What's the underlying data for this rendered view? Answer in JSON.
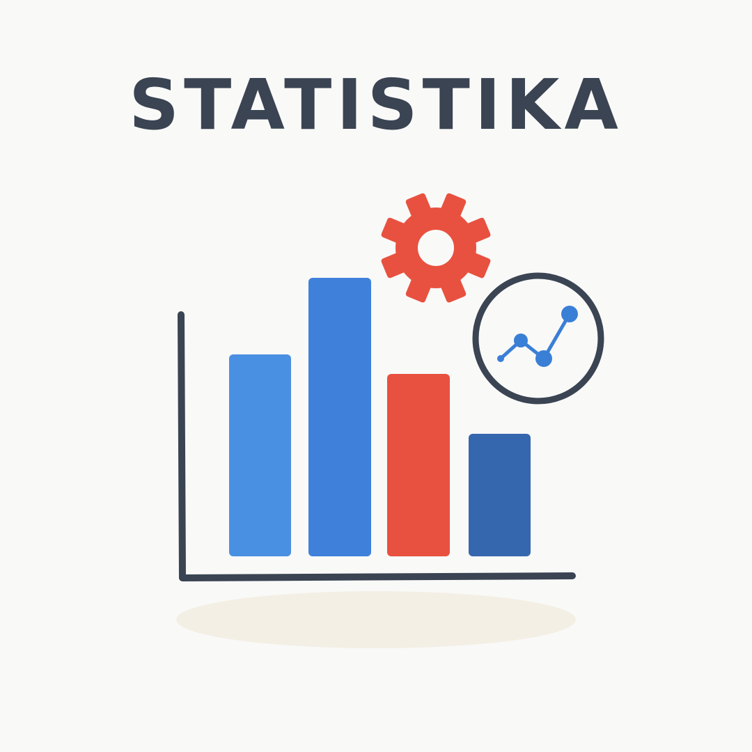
{
  "title": "STATISTIKA",
  "colors": {
    "text": "#3a4452",
    "axis": "#3a4452",
    "bar_light_blue": "#4a90e2",
    "bar_blue": "#3f80db",
    "bar_red": "#e8513f",
    "bar_dark_blue": "#3567ae",
    "gear": "#e8513f",
    "trend_line": "#3a7fd6",
    "shadow": "#f3efe4",
    "background": "#f9f9f8"
  },
  "icons": [
    "bar-chart-icon",
    "gear-icon",
    "trend-chart-circle-icon"
  ],
  "bars": [
    {
      "name": "bar-1",
      "color": "bar_light_blue",
      "level": 0.725
    },
    {
      "name": "bar-2",
      "color": "bar_blue",
      "level": 1.0
    },
    {
      "name": "bar-3",
      "color": "bar_red",
      "level": 0.655
    },
    {
      "name": "bar-4",
      "color": "bar_dark_blue",
      "level": 0.44
    }
  ]
}
